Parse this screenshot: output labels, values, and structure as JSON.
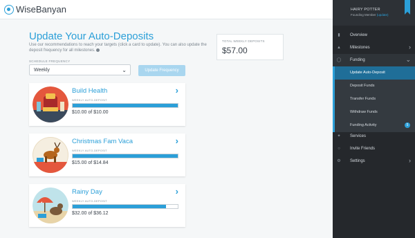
{
  "app": {
    "brand": "WiseBanyan"
  },
  "page": {
    "title": "Update Your Auto-Deposits",
    "description": "Use our recommendations to reach your targets (click a card to update). You can also update the deposit frequency for all milestones.",
    "frequency_label": "SCHEDULE FREQUENCY",
    "frequency_value": "Weekly",
    "update_button": "Update Frequency",
    "total_label": "TOTAL WEEKLY DEPOSITS",
    "total_value": "$57.00"
  },
  "cards": [
    {
      "title": "Build Health",
      "sub": "WEEKLY AUTO-DEPOSIT",
      "amount": "$10.00 of $10.00",
      "progress": 1.0
    },
    {
      "title": "Christmas Fam Vaca",
      "sub": "WEEKLY AUTO-DEPOSIT",
      "amount": "$15.00 of $14.84",
      "progress": 1.0
    },
    {
      "title": "Rainy Day",
      "sub": "WEEKLY AUTO-DEPOSIT",
      "amount": "$32.00 of $36.12",
      "progress": 0.886
    }
  ],
  "profile": {
    "name": "HAIRY POTTER",
    "role": "Founding Member",
    "link": "(update)"
  },
  "nav": {
    "overview": "Overview",
    "milestones": "Milestones",
    "funding": "Funding",
    "funding_items": [
      "Update Auto-Deposit",
      "Deposit Funds",
      "Transfer Funds",
      "Withdraw Funds",
      "Funding Activity"
    ],
    "funding_badge": "5",
    "services": "Services",
    "invite": "Invite Friends",
    "settings": "Settings"
  },
  "colors": {
    "accent": "#2b9fd8",
    "sidebar": "#25282c",
    "active": "#1f6e98"
  }
}
